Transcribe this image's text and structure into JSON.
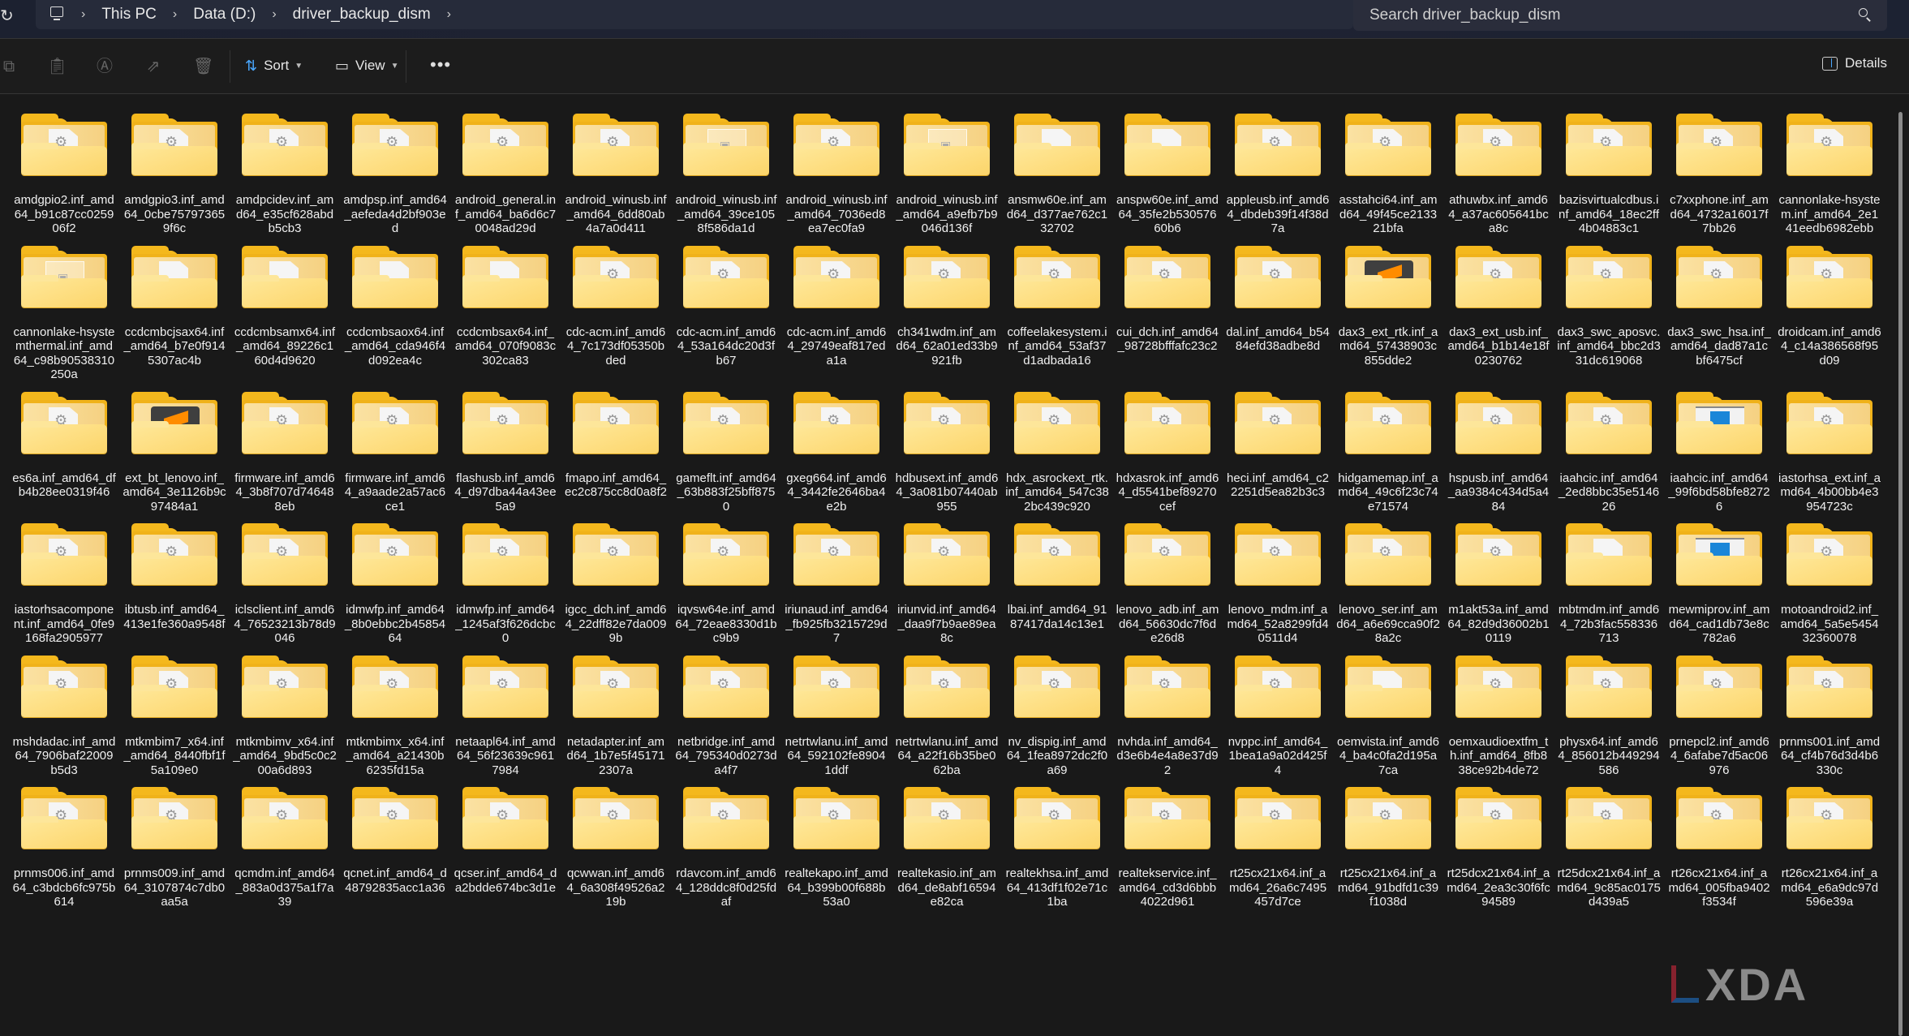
{
  "address_bar": {
    "refresh_icon": "refresh-icon",
    "pc_icon": "computer-icon",
    "breadcrumb": [
      "This PC",
      "Data (D:)",
      "driver_backup_dism"
    ],
    "separator": "›"
  },
  "search": {
    "placeholder": "Search driver_backup_dism",
    "icon": "search-icon"
  },
  "toolbar": {
    "icons": [
      "copy-icon",
      "paste-icon",
      "rename-icon",
      "share-icon",
      "delete-icon"
    ],
    "sort_label": "Sort",
    "view_label": "View",
    "more_label": "•••",
    "details_label": "Details"
  },
  "watermark": "XDA",
  "files": [
    {
      "name": "amdgpio2.inf_amd64_b91c87cc025906f2",
      "icon": "gear"
    },
    {
      "name": "amdgpio3.inf_amd64_0cbe757973659f6c",
      "icon": "gear"
    },
    {
      "name": "amdpcidev.inf_amd64_e35cf628abdb5cb3",
      "icon": "gear"
    },
    {
      "name": "amdpsp.inf_amd64_aefeda4d2bf903ed",
      "icon": "gear"
    },
    {
      "name": "android_general.inf_amd64_ba6d6c70048ad29d",
      "icon": "gear"
    },
    {
      "name": "android_winusb.inf_amd64_6dd80ab4a7a0d411",
      "icon": "gear"
    },
    {
      "name": "android_winusb.inf_amd64_39ce1058f586da1d",
      "icon": "sheet"
    },
    {
      "name": "android_winusb.inf_amd64_7036ed8ea7ec0fa9",
      "icon": "gear"
    },
    {
      "name": "android_winusb.inf_amd64_a9efb7b9046d136f",
      "icon": "sheet"
    },
    {
      "name": "ansmw60e.inf_amd64_d377ae762c132702",
      "icon": "blank"
    },
    {
      "name": "anspw60e.inf_amd64_35fe2b53057660b6",
      "icon": "blank"
    },
    {
      "name": "appleusb.inf_amd64_dbdeb39f14f38d7a",
      "icon": "gear"
    },
    {
      "name": "asstahci64.inf_amd64_49f45ce213321bfa",
      "icon": "gear"
    },
    {
      "name": "athuwbx.inf_amd64_a37ac605641bca8c",
      "icon": "gear"
    },
    {
      "name": "bazisvirtualcdbus.inf_amd64_18ec2ff4b04883c1",
      "icon": "gear"
    },
    {
      "name": "c7xxphone.inf_amd64_4732a16017f7bb26",
      "icon": "gear"
    },
    {
      "name": "cannonlake-hsystem.inf_amd64_2e141eedb6982ebb",
      "icon": "gear"
    },
    {
      "name": "cannonlake-hsystemthermal.inf_amd64_c98b90538310250a",
      "icon": "sheet"
    },
    {
      "name": "ccdcmbcjsax64.inf_amd64_b7e0f9145307ac4b",
      "icon": "blank"
    },
    {
      "name": "ccdcmbsamx64.inf_amd64_89226c160d4d9620",
      "icon": "blank"
    },
    {
      "name": "ccdcmbsaox64.inf_amd64_cda946f4d092ea4c",
      "icon": "blank"
    },
    {
      "name": "ccdcmbsax64.inf_amd64_070f9083c302ca83",
      "icon": "blank"
    },
    {
      "name": "cdc-acm.inf_amd64_7c173df05350bded",
      "icon": "gear"
    },
    {
      "name": "cdc-acm.inf_amd64_53a164dc20d3fb67",
      "icon": "gear"
    },
    {
      "name": "cdc-acm.inf_amd64_29749eaf817eda1a",
      "icon": "gear"
    },
    {
      "name": "ch341wdm.inf_amd64_62a01ed33b9921fb",
      "icon": "gear"
    },
    {
      "name": "coffeelakesystem.inf_amd64_53af37d1adbada16",
      "icon": "gear"
    },
    {
      "name": "cui_dch.inf_amd64_98728bfffafc23c2",
      "icon": "gear"
    },
    {
      "name": "dal.inf_amd64_b5484efd38adbe8d",
      "icon": "gear"
    },
    {
      "name": "dax3_ext_rtk.inf_amd64_57438903c855dde2",
      "icon": "app-dark"
    },
    {
      "name": "dax3_ext_usb.inf_amd64_b1b14e18f0230762",
      "icon": "gear"
    },
    {
      "name": "dax3_swc_aposvc.inf_amd64_bbc2d331dc619068",
      "icon": "gear"
    },
    {
      "name": "dax3_swc_hsa.inf_amd64_dad87a1cbf6475cf",
      "icon": "gear"
    },
    {
      "name": "droidcam.inf_amd64_c14a386568f95d09",
      "icon": "gear"
    },
    {
      "name": "es6a.inf_amd64_dfb4b28ee0319f46",
      "icon": "gear"
    },
    {
      "name": "ext_bt_lenovo.inf_amd64_3e1126b9c97484a1",
      "icon": "app-dark"
    },
    {
      "name": "firmware.inf_amd64_3b8f707d746488eb",
      "icon": "gear"
    },
    {
      "name": "firmware.inf_amd64_a9aade2a57ac6ce1",
      "icon": "gear"
    },
    {
      "name": "flashusb.inf_amd64_d97dba44a43ee5a9",
      "icon": "gear"
    },
    {
      "name": "fmapo.inf_amd64_ec2c875cc8d0a8f2",
      "icon": "gear"
    },
    {
      "name": "gameflt.inf_amd64_63b883f25bff8750",
      "icon": "gear"
    },
    {
      "name": "gxeg664.inf_amd64_3442fe2646ba4e2b",
      "icon": "gear"
    },
    {
      "name": "hdbusext.inf_amd64_3a081b07440ab955",
      "icon": "gear"
    },
    {
      "name": "hdx_asrockext_rtk.inf_amd64_547c382bc439c920",
      "icon": "gear"
    },
    {
      "name": "hdxasrok.inf_amd64_d5541bef89270cef",
      "icon": "gear"
    },
    {
      "name": "heci.inf_amd64_c22251d5ea82b3c3",
      "icon": "gear"
    },
    {
      "name": "hidgamemap.inf_amd64_49c6f23c74e71574",
      "icon": "gear"
    },
    {
      "name": "hspusb.inf_amd64_aa9384c434d5a484",
      "icon": "gear"
    },
    {
      "name": "iaahcic.inf_amd64_2ed8bbc35e514626",
      "icon": "gear"
    },
    {
      "name": "iaahcic.inf_amd64_99f6bd58bfe82726",
      "icon": "app-win"
    },
    {
      "name": "iastorhsa_ext.inf_amd64_4b00bb4e3954723c",
      "icon": "gear"
    },
    {
      "name": "iastorhsacomponent.inf_amd64_0fe9168fa2905977",
      "icon": "gear"
    },
    {
      "name": "ibtusb.inf_amd64_413e1fe360a9548f",
      "icon": "gear"
    },
    {
      "name": "iclsclient.inf_amd64_76523213b78d9046",
      "icon": "gear"
    },
    {
      "name": "idmwfp.inf_amd64_8b0ebbc2b4585464",
      "icon": "gear"
    },
    {
      "name": "idmwfp.inf_amd64_1245af3f626dcbc0",
      "icon": "gear"
    },
    {
      "name": "igcc_dch.inf_amd64_22dff82e7da0099b",
      "icon": "gear"
    },
    {
      "name": "iqvsw64e.inf_amd64_72eae8330d1bc9b9",
      "icon": "gear"
    },
    {
      "name": "iriunaud.inf_amd64_fb925fb3215729d7",
      "icon": "gear"
    },
    {
      "name": "iriunvid.inf_amd64_daa9f7b9ae89ea8c",
      "icon": "gear"
    },
    {
      "name": "lbai.inf_amd64_9187417da14c13e1",
      "icon": "gear"
    },
    {
      "name": "lenovo_adb.inf_amd64_56630dc7f6de26d8",
      "icon": "gear"
    },
    {
      "name": "lenovo_mdm.inf_amd64_52a8299fd40511d4",
      "icon": "gear"
    },
    {
      "name": "lenovo_ser.inf_amd64_a6e69cca90f28a2c",
      "icon": "gear"
    },
    {
      "name": "m1akt53a.inf_amd64_82d9d36002b10119",
      "icon": "gear"
    },
    {
      "name": "mbtmdm.inf_amd64_72b3fac558336713",
      "icon": "blank"
    },
    {
      "name": "mewmiprov.inf_amd64_cad1db73e8c782a6",
      "icon": "app-win"
    },
    {
      "name": "motoandroid2.inf_amd64_5a5e545432360078",
      "icon": "gear"
    },
    {
      "name": "mshdadac.inf_amd64_7906baf22009b5d3",
      "icon": "gear"
    },
    {
      "name": "mtkmbim7_x64.inf_amd64_8440fbf1f5a109e0",
      "icon": "gear"
    },
    {
      "name": "mtkmbimv_x64.inf_amd64_9bd5c0c200a6d893",
      "icon": "gear"
    },
    {
      "name": "mtkmbimx_x64.inf_amd64_a21430b6235fd15a",
      "icon": "gear"
    },
    {
      "name": "netaapl64.inf_amd64_56f23639c9617984",
      "icon": "gear"
    },
    {
      "name": "netadapter.inf_amd64_1b7e5f451712307a",
      "icon": "gear"
    },
    {
      "name": "netbridge.inf_amd64_795340d0273da4f7",
      "icon": "gear"
    },
    {
      "name": "netrtwlanu.inf_amd64_592102fe89041ddf",
      "icon": "gear"
    },
    {
      "name": "netrtwlanu.inf_amd64_a22f16b35be062ba",
      "icon": "gear"
    },
    {
      "name": "nv_dispig.inf_amd64_1fea8972dc2f0a69",
      "icon": "gear"
    },
    {
      "name": "nvhda.inf_amd64_d3e6b4e4a8e37d92",
      "icon": "gear"
    },
    {
      "name": "nvppc.inf_amd64_1bea1a9a02d425f4",
      "icon": "gear"
    },
    {
      "name": "oemvista.inf_amd64_ba4c0fa2d195a7ca",
      "icon": "blank"
    },
    {
      "name": "oemxaudioextfm_th.inf_amd64_8fb838ce92b4de72",
      "icon": "gear"
    },
    {
      "name": "physx64.inf_amd64_856012b449294586",
      "icon": "gear"
    },
    {
      "name": "prnepcl2.inf_amd64_6afabe7d5ac06976",
      "icon": "gear"
    },
    {
      "name": "prnms001.inf_amd64_cf4b76d3d4b6330c",
      "icon": "gear"
    },
    {
      "name": "prnms006.inf_amd64_c3bdcb6fc975b614",
      "icon": "gear"
    },
    {
      "name": "prnms009.inf_amd64_3107874c7db0aa5a",
      "icon": "gear"
    },
    {
      "name": "qcmdm.inf_amd64_883a0d375a1f7a39",
      "icon": "gear"
    },
    {
      "name": "qcnet.inf_amd64_d48792835acc1a36",
      "icon": "gear"
    },
    {
      "name": "qcser.inf_amd64_da2bdde674bc3d1e",
      "icon": "gear"
    },
    {
      "name": "qcwwan.inf_amd64_6a308f49526a219b",
      "icon": "gear"
    },
    {
      "name": "rdavcom.inf_amd64_128ddc8f0d25fdaf",
      "icon": "gear"
    },
    {
      "name": "realtekapo.inf_amd64_b399b00f688b53a0",
      "icon": "gear"
    },
    {
      "name": "realtekasio.inf_amd64_de8abf16594e82ca",
      "icon": "gear"
    },
    {
      "name": "realtekhsa.inf_amd64_413df1f02e71c1ba",
      "icon": "gear"
    },
    {
      "name": "realtekservice.inf_amd64_cd3d6bbb4022d961",
      "icon": "gear"
    },
    {
      "name": "rt25cx21x64.inf_amd64_26a6c7495457d7ce",
      "icon": "gear"
    },
    {
      "name": "rt25cx21x64.inf_amd64_91bdfd1c39f1038d",
      "icon": "gear"
    },
    {
      "name": "rt25dcx21x64.inf_amd64_2ea3c30f6fc94589",
      "icon": "gear"
    },
    {
      "name": "rt25dcx21x64.inf_amd64_9c85ac0175d439a5",
      "icon": "gear"
    },
    {
      "name": "rt26cx21x64.inf_amd64_005fba9402f3534f",
      "icon": "gear"
    },
    {
      "name": "rt26cx21x64.inf_amd64_e6a9dc97d596e39a",
      "icon": "gear"
    }
  ]
}
